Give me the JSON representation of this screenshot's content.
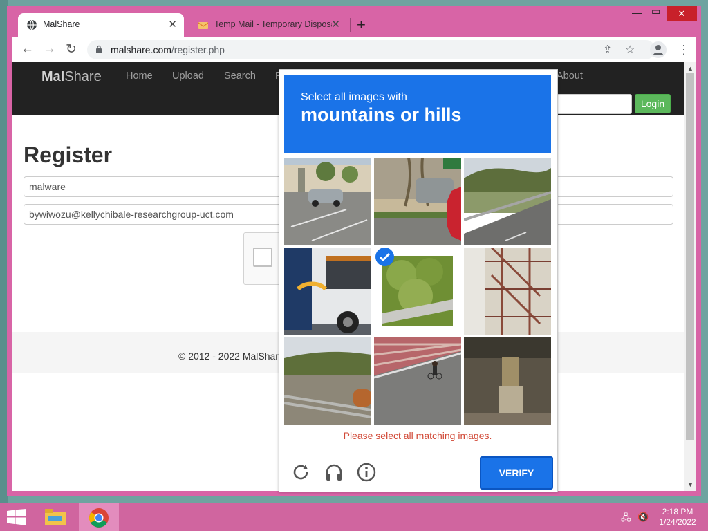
{
  "browser": {
    "tabs": [
      {
        "title": "MalShare",
        "active": true
      },
      {
        "title": "Temp Mail - Temporary Disposab",
        "active": false
      }
    ],
    "url_domain": "malshare.com",
    "url_path": "/register.php"
  },
  "site": {
    "brand_bold": "Mal",
    "brand_rest": "Share",
    "nav": [
      "Home",
      "Upload",
      "Search",
      "F",
      "About"
    ],
    "login_label": "Login",
    "heading": "Register",
    "username_value": "malware",
    "email_value": "bywiwozu@kellychibale-researchgroup-uct.com",
    "footer": "© 2012 - 2022 MalShar"
  },
  "captcha": {
    "instruction": "Select all images with",
    "target": "mountains or hills",
    "error": "Please select all matching images.",
    "verify_label": "VERIFY",
    "tiles": [
      {
        "name": "parking-lot-tile",
        "selected": false
      },
      {
        "name": "stop-sign-tile",
        "selected": false
      },
      {
        "name": "road-hills-tile",
        "selected": false
      },
      {
        "name": "bus-tile",
        "selected": false
      },
      {
        "name": "green-hill-tile",
        "selected": true
      },
      {
        "name": "fire-escape-tile",
        "selected": false
      },
      {
        "name": "guardrail-hills-tile",
        "selected": false
      },
      {
        "name": "cyclist-tile",
        "selected": false
      },
      {
        "name": "bridge-underside-tile",
        "selected": false
      }
    ]
  },
  "taskbar": {
    "time": "2:18 PM",
    "date": "1/24/2022"
  },
  "colors": {
    "accent": "#1a73e8",
    "window_frame": "#d864a6",
    "login_green": "#5cb85c",
    "error_red": "#d14836"
  }
}
